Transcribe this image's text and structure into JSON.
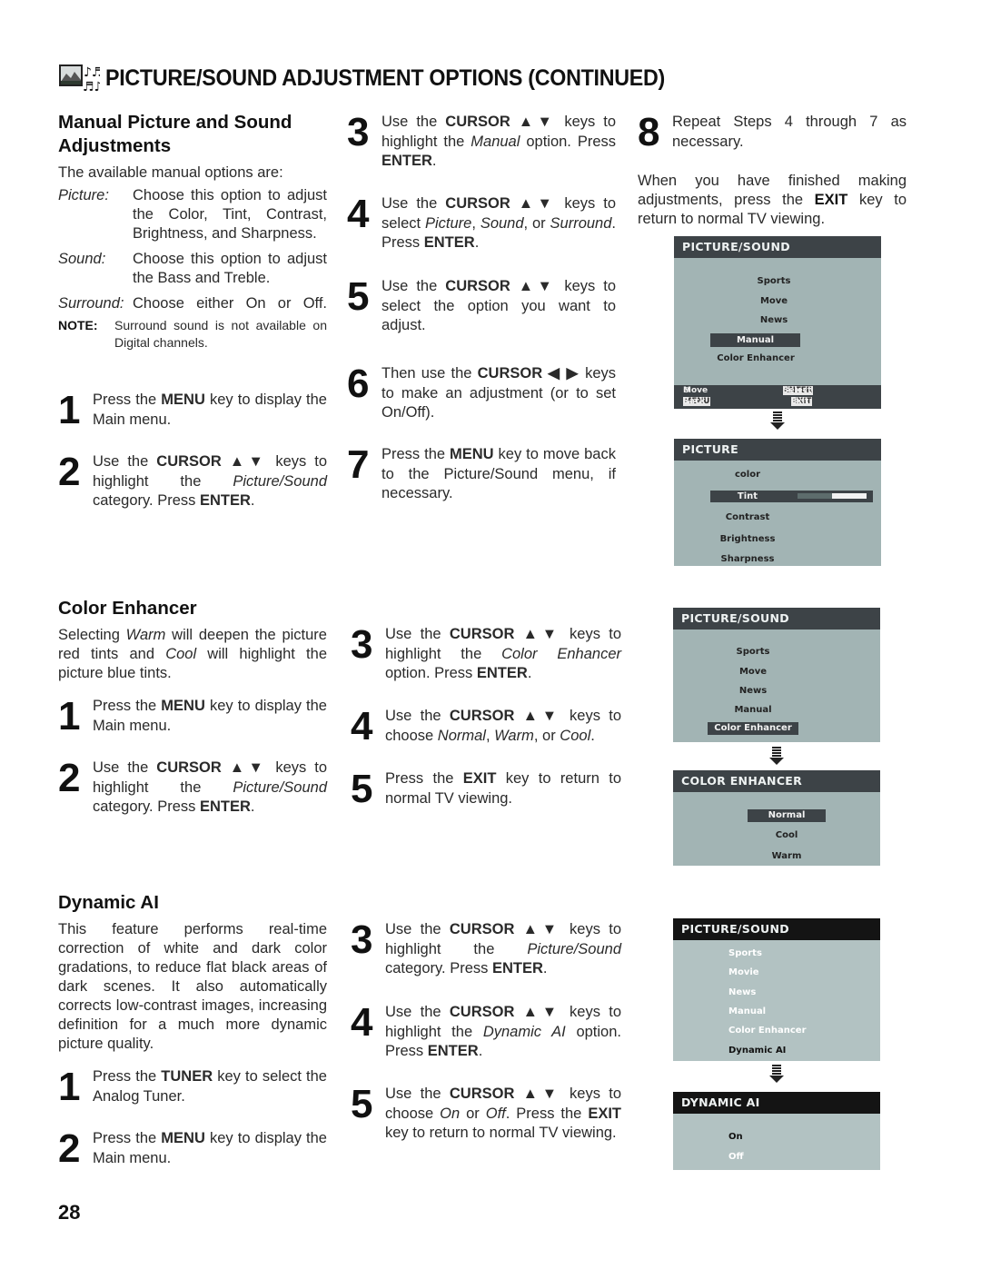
{
  "header": {
    "icon": "picture-sound-icon",
    "title": "PICTURE/SOUND ADJUSTMENT OPTIONS (CONTINUED)"
  },
  "manual": {
    "heading_line1": "Manual Picture and Sound",
    "heading_line2": "Adjustments",
    "intro": "The available manual options are:",
    "options": [
      {
        "term": "Picture:",
        "def": "Choose this option to adjust the Color, Tint, Contrast, Brightness, and Sharpness."
      },
      {
        "term": "Sound:",
        "def": "Choose this option to adjust the Bass and Treble."
      },
      {
        "term": "Surround:",
        "def": "Choose either On or Off."
      }
    ],
    "note_label": "NOTE:",
    "note_text": "Surround sound is not available on Digital channels.",
    "steps": [
      {
        "num": "1",
        "html": "Press the <b>MENU</b> key to display the Main menu."
      },
      {
        "num": "2",
        "html": "Use the <b>CURSOR ▲▼</b> keys to highlight the <i>Picture/Sound</i> category. Press <b>ENTER</b>."
      },
      {
        "num": "3",
        "html": "Use the <b>CURSOR ▲▼</b> keys to highlight the <i>Manual</i> option. Press <b>ENTER</b>."
      },
      {
        "num": "4",
        "html": "Use the <b>CURSOR ▲▼</b> keys to select <i>Picture</i>, <i>Sound</i>, or <i>Surround</i>. Press <b>ENTER</b>."
      },
      {
        "num": "5",
        "html": "Use the <b>CURSOR ▲▼</b> keys to select the option you want to adjust."
      },
      {
        "num": "6",
        "html": "Then use the <b>CURSOR ◀ ▶</b> keys to make an adjustment (or to set On/Off)."
      },
      {
        "num": "7",
        "html": "Press the <b>MENU</b> key to move back to the Picture/Sound menu, if necessary."
      },
      {
        "num": "8",
        "html": "Repeat Steps 4 through 7 as necessary."
      }
    ],
    "closing_html": "When you have finished making adjustments, press the <b>EXIT</b> key to return to normal TV viewing.",
    "osd1": {
      "title": "PICTURE/SOUND",
      "items": [
        "Sports",
        "Move",
        "News",
        "Manual",
        "Color Enhancer"
      ],
      "selected": "Manual",
      "footer": {
        "move": "Move",
        "enter_key": "ENTER",
        "select": "Select",
        "menu_key": "MENU",
        "back": "Back",
        "exit_key": "EXIT",
        "exit": "Exit"
      }
    },
    "osd2": {
      "title": "PICTURE",
      "items": [
        "color",
        "Tint",
        "Contrast",
        "Brightness",
        "Sharpness"
      ],
      "selected": "Tint",
      "tint_level": 0.5
    }
  },
  "color_enhancer": {
    "heading": "Color Enhancer",
    "intro_html": "Selecting <i>Warm</i> will deepen the picture red tints and <i>Cool</i> will highlight the picture blue tints.",
    "steps": [
      {
        "num": "1",
        "html": "Press the <b>MENU</b> key to display the Main menu."
      },
      {
        "num": "2",
        "html": "Use the <b>CURSOR ▲▼</b> keys to highlight the <i>Picture/Sound</i> category. Press <b>ENTER</b>."
      },
      {
        "num": "3",
        "html": "Use the <b>CURSOR ▲▼</b> keys to highlight the <i>Color Enhancer</i> option. Press <b>ENTER</b>."
      },
      {
        "num": "4",
        "html": "Use the <b>CURSOR ▲▼</b> keys to choose <i>Normal</i>, <i>Warm</i>, or <i>Cool</i>."
      },
      {
        "num": "5",
        "html": "Press the <b>EXIT</b> key to return to normal TV viewing."
      }
    ],
    "osd1": {
      "title": "PICTURE/SOUND",
      "items": [
        "Sports",
        "Move",
        "News",
        "Manual",
        "Color Enhancer"
      ],
      "selected": "Color Enhancer"
    },
    "osd2": {
      "title": "COLOR ENHANCER",
      "items": [
        "Normal",
        "Cool",
        "Warm"
      ],
      "selected": "Normal"
    }
  },
  "dynamic_ai": {
    "heading": "Dynamic AI",
    "intro": "This feature performs real-time correction of white and dark color gradations,  to reduce flat black areas of dark scenes. It also automatically corrects low-contrast images, increasing definition for a much more dynamic picture quality.",
    "steps": [
      {
        "num": "1",
        "html": "Press the <b>TUNER</b> key to select the Analog Tuner."
      },
      {
        "num": "2",
        "html": "Press the <b>MENU</b> key to display the Main menu."
      },
      {
        "num": "3",
        "html": "Use the <b>CURSOR ▲▼</b> keys to highlight the <i>Picture/Sound</i> category. Press <b>ENTER</b>."
      },
      {
        "num": "4",
        "html": "Use the <b>CURSOR ▲▼</b> keys to highlight the <i>Dynamic AI</i> option. Press <b>ENTER</b>."
      },
      {
        "num": "5",
        "html": "Use the <b>CURSOR ▲▼</b> keys to choose <i>On</i> or <i>Off</i>. Press the <b>EXIT</b> key to return to normal TV viewing."
      }
    ],
    "osd1": {
      "title": "PICTURE/SOUND",
      "items": [
        "Sports",
        "Movie",
        "News",
        "Manual",
        "Color Enhancer",
        "Dynamic AI"
      ],
      "selected": "Dynamic AI"
    },
    "osd2": {
      "title": "DYNAMIC AI",
      "items": [
        "On",
        "Off"
      ],
      "selected": "On"
    }
  },
  "page_number": "28"
}
